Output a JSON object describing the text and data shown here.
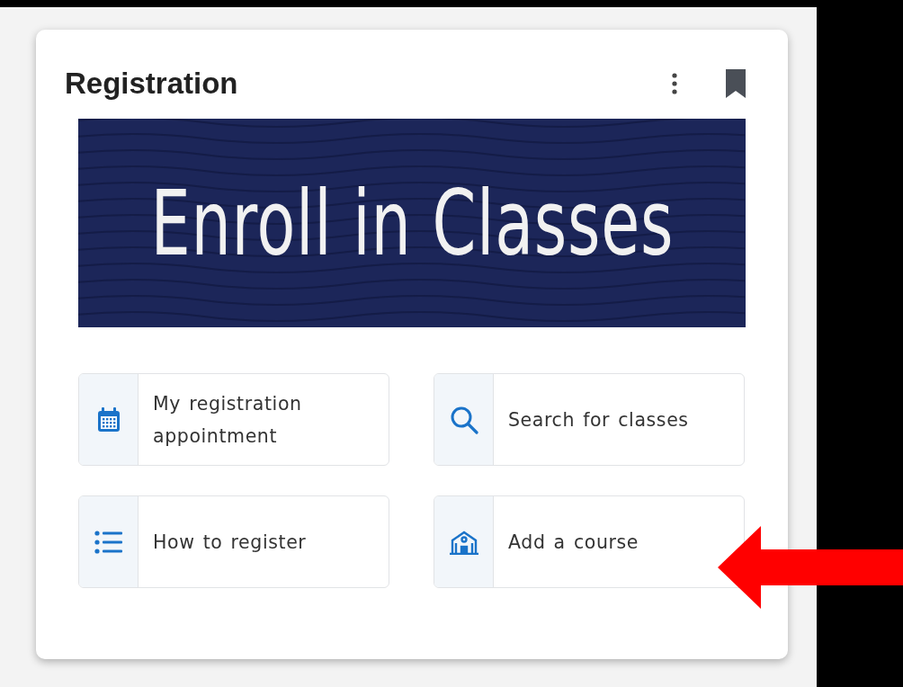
{
  "card": {
    "title": "Registration",
    "banner": {
      "title": "Enroll in Classes"
    },
    "links": [
      {
        "kind": "calendar",
        "label": "My registration appointment"
      },
      {
        "kind": "search",
        "label": "Search for classes"
      },
      {
        "kind": "list",
        "label": "How to register"
      },
      {
        "kind": "building",
        "label": "Add a course"
      }
    ]
  }
}
